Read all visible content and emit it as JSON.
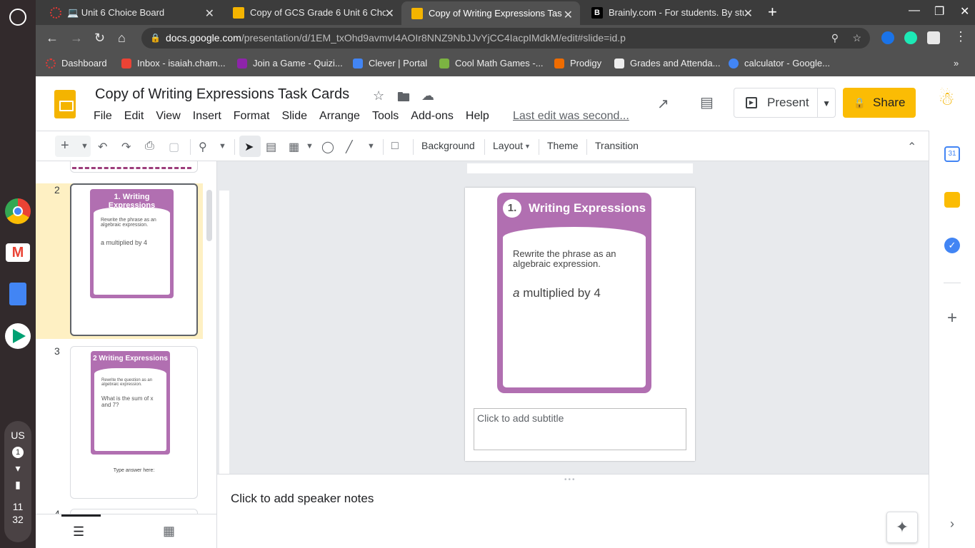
{
  "browser": {
    "tabs": [
      {
        "title": "💻 Unit 6 Choice Board",
        "color": "#e53935"
      },
      {
        "title": "Copy of GCS Grade 6 Unit 6 Choi",
        "color": "#f4b400"
      },
      {
        "title": "Copy of Writing Expressions Tas",
        "color": "#f4b400"
      },
      {
        "title": "Brainly.com - For students. By stu",
        "color": "#000000"
      }
    ],
    "url_domain": "docs.google.com",
    "url_path": "/presentation/d/1EM_txOhd9avmvI4AOIr8NNZ9NbJJvYjCC4IacpIMdkM/edit#slide=id.p",
    "bookmarks": [
      {
        "label": "Dashboard",
        "color": "#e53935"
      },
      {
        "label": "Inbox - isaiah.cham...",
        "color": "#ea4335"
      },
      {
        "label": "Join a Game - Quizi...",
        "color": "#8e24aa"
      },
      {
        "label": "Clever | Portal",
        "color": "#4285f4"
      },
      {
        "label": "Cool Math Games -...",
        "color": "#7cb342"
      },
      {
        "label": "Prodigy",
        "color": "#ef6c00"
      },
      {
        "label": "Grades and Attenda...",
        "color": "#eeeeee"
      },
      {
        "label": "calculator - Google...",
        "color": "#4285f4"
      }
    ]
  },
  "doc": {
    "title": "Copy of Writing Expressions Task Cards",
    "menu": [
      "File",
      "Edit",
      "View",
      "Insert",
      "Format",
      "Slide",
      "Arrange",
      "Tools",
      "Add-ons",
      "Help"
    ],
    "last_edit": "Last edit was second...",
    "present_label": "Present",
    "share_label": "Share"
  },
  "toolbar": {
    "background": "Background",
    "layout": "Layout",
    "theme": "Theme",
    "transition": "Transition"
  },
  "filmstrip": {
    "slide2_num": "2",
    "slide3_num": "3",
    "slide4_num": "4",
    "slide2": {
      "num": "1.",
      "title": "Writing Expressions",
      "q": "Rewrite the phrase as an algebraic expression.",
      "expr": "a multiplied by 4"
    },
    "slide3": {
      "num": "2",
      "title": "Writing Expressions",
      "q": "Rewrite the question as an algebraic expression.",
      "expr": "What is the sum of x and 7?",
      "answer": "Type answer here:"
    }
  },
  "slide": {
    "num": "1.",
    "title": "Writing Expressions",
    "question": "Rewrite the phrase as an algebraic expression.",
    "expr_var": "a",
    "expr_rest": " multiplied by 4",
    "subtitle_placeholder": "Click to add subtitle"
  },
  "notes": {
    "placeholder": "Click to add speaker notes"
  },
  "system": {
    "locale": "US",
    "notif": "1",
    "time_h": "11",
    "time_m": "32"
  },
  "colors": {
    "card": "#b16fb1",
    "accent": "#fbbc04",
    "selected_thumb_bg": "#fef0c3"
  }
}
